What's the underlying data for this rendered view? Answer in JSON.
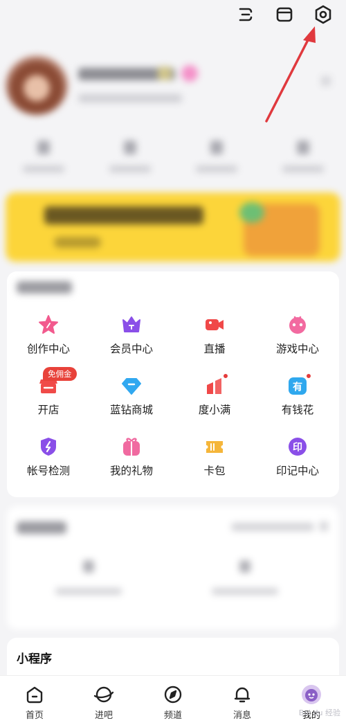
{
  "top_bar": {
    "icons": [
      "scan-icon",
      "wardrobe-icon",
      "settings-icon"
    ]
  },
  "tools": {
    "items": [
      {
        "label": "创作中心",
        "icon": "star-icon",
        "color": "#f25a8e"
      },
      {
        "label": "会员中心",
        "icon": "crown-icon",
        "color": "#8a4fe8"
      },
      {
        "label": "直播",
        "icon": "video-camera-icon",
        "color": "#f04848"
      },
      {
        "label": "游戏中心",
        "icon": "gamepad-icon",
        "color": "#f26aa0"
      },
      {
        "label": "开店",
        "icon": "store-icon",
        "color": "#f04a48",
        "tag": "免佣金"
      },
      {
        "label": "蓝钻商城",
        "icon": "diamond-icon",
        "color": "#31a8f0"
      },
      {
        "label": "度小满",
        "icon": "chart-icon",
        "color": "#f04848",
        "dot": true
      },
      {
        "label": "有钱花",
        "icon": "money-icon",
        "color": "#2fa8ee",
        "dot": true
      },
      {
        "label": "帐号检测",
        "icon": "shield-icon",
        "color": "#8a4fe8"
      },
      {
        "label": "我的礼物",
        "icon": "gift-icon",
        "color": "#f06aa0"
      },
      {
        "label": "卡包",
        "icon": "ticket-icon",
        "color": "#f5b63a"
      },
      {
        "label": "印记中心",
        "icon": "seal-icon",
        "color": "#8a4fe8"
      }
    ]
  },
  "mini_programs": {
    "title": "小程序"
  },
  "tabbar": {
    "tabs": [
      {
        "label": "首页",
        "icon": "home-icon"
      },
      {
        "label": "进吧",
        "icon": "planet-icon"
      },
      {
        "label": "频道",
        "icon": "compass-icon"
      },
      {
        "label": "消息",
        "icon": "bell-icon"
      },
      {
        "label": "我的",
        "icon": "avatar-icon",
        "active": true
      }
    ]
  },
  "watermark": "Bai du 经验"
}
